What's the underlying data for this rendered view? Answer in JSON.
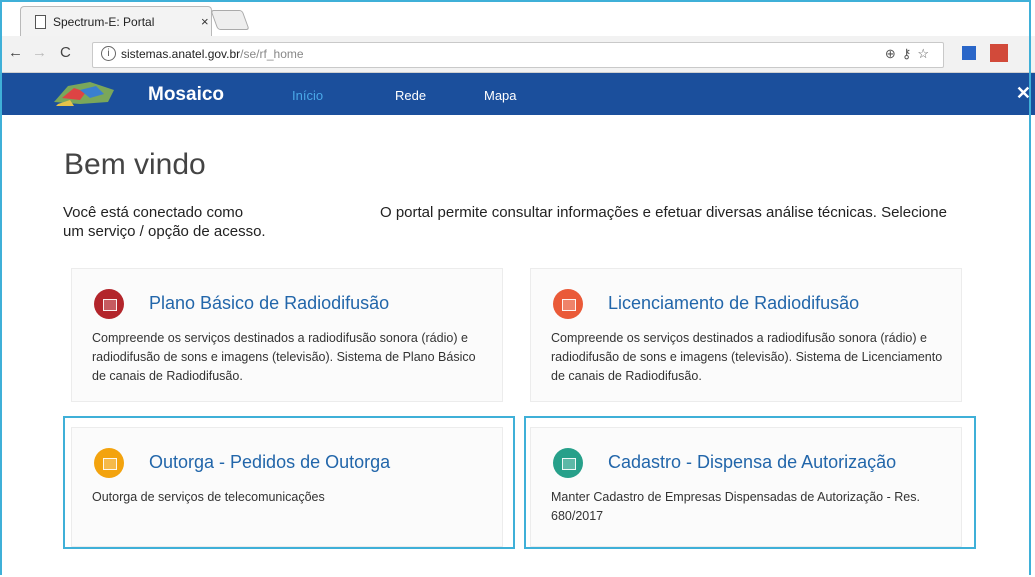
{
  "browser": {
    "tab_title": "Spectrum-E: Portal",
    "tab_close": "×",
    "url_main": "sistemas.anatel.gov.br",
    "url_path": "/se/rf_home"
  },
  "app": {
    "brand": "Mosaico",
    "nav": [
      "Início",
      "Rede",
      "Mapa"
    ]
  },
  "welcome": {
    "title": "Bem vindo",
    "line1": "Você está conectado como",
    "line2": "O portal permite consultar informações e efetuar diversas análise técnicas. Selecione",
    "line3": "um serviço / opção de acesso."
  },
  "cards": [
    {
      "title": "Plano Básico de Radiodifusão",
      "description": "Compreende os serviços destinados a radiodifusão sonora (rádio) e radiodifusão de sons e imagens (televisão). Sistema de Plano Básico de canais de Radiodifusão.",
      "color": "#b3252b"
    },
    {
      "title": "Licenciamento de Radiodifusão",
      "description": "Compreende os serviços destinados a radiodifusão sonora (rádio) e radiodifusão de sons e imagens (televisão). Sistema de Licenciamento de canais de Radiodifusão.",
      "color": "#ea5a38"
    },
    {
      "title": "Outorga - Pedidos de Outorga",
      "description": "Outorga de serviços de telecomunicações",
      "color": "#f3a30e"
    },
    {
      "title": "Cadastro - Dispensa de Autorização",
      "description": "Manter Cadastro de Empresas Dispensadas de Autorização - Res. 680/2017",
      "color": "#27a08a"
    }
  ]
}
